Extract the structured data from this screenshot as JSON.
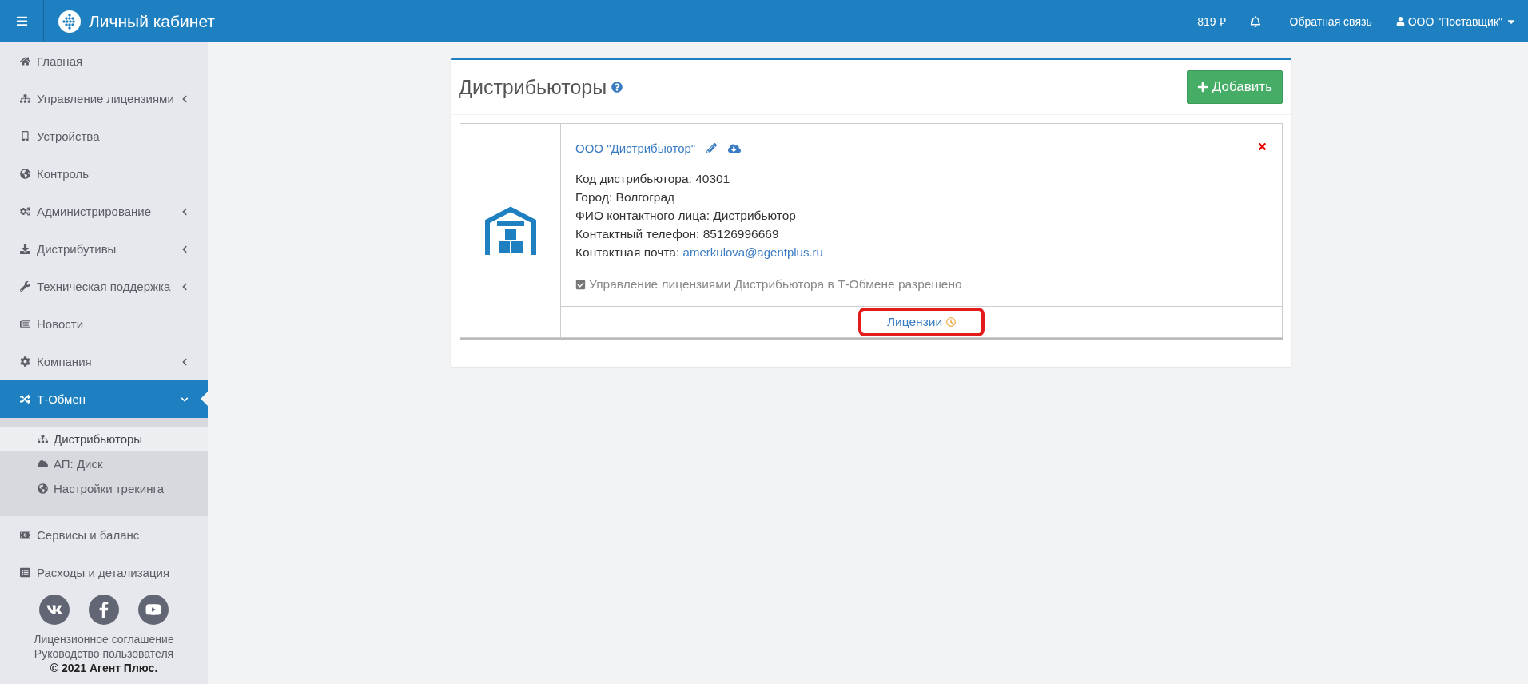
{
  "header": {
    "title": "Личный кабинет",
    "balance": "819 ₽",
    "feedback": "Обратная связь",
    "user": "ООО \"Поставщик\""
  },
  "sidebar": {
    "items": [
      {
        "label": "Главная",
        "selected": false
      },
      {
        "label": "Управление лицензиями",
        "selected": false,
        "expanded": false
      },
      {
        "label": "Устройства",
        "selected": false
      },
      {
        "label": "Контроль",
        "selected": false
      },
      {
        "label": "Администрирование",
        "selected": false,
        "expanded": false
      },
      {
        "label": "Дистрибутивы",
        "selected": false,
        "expanded": false
      },
      {
        "label": "Техническая поддержка",
        "selected": false,
        "expanded": false
      },
      {
        "label": "Новости",
        "selected": false
      },
      {
        "label": "Компания",
        "selected": false,
        "expanded": false
      },
      {
        "label": "Т-Обмен",
        "selected": true,
        "expanded": true,
        "children": [
          {
            "label": "Дистрибьюторы",
            "selected": true
          },
          {
            "label": "АП: Диск",
            "selected": false
          },
          {
            "label": "Настройки трекинга",
            "selected": false
          }
        ]
      },
      {
        "label": "Сервисы и баланс",
        "selected": false
      },
      {
        "label": "Расходы и детализация",
        "selected": false
      }
    ],
    "footer_links": [
      "Лицензионное соглашение",
      "Руководство пользователя"
    ],
    "copyright": "© 2021 Агент Плюс."
  },
  "panel": {
    "title": "Дистрибьюторы",
    "add_button": "Добавить",
    "distributors": [
      {
        "name": "ООО \"Дистрибьютор\"",
        "fields": [
          {
            "label": "Код дистрибьютора:",
            "value": "40301"
          },
          {
            "label": "Город:",
            "value": "Волгоград"
          },
          {
            "label": "ФИО контактного лица:",
            "value": "Дистрибьютор"
          },
          {
            "label": "Контактный телефон:",
            "value": "85126996669"
          },
          {
            "label": "Контактная почта:",
            "value": "amerkulova@agentplus.ru",
            "kind": "link"
          }
        ],
        "permission": {
          "label": "Управление лицензиями Дистрибьютора в Т-Обмене разрешено",
          "checked": true
        },
        "licenses_link": {
          "label": "Лицензии",
          "highlighted": true
        }
      }
    ]
  }
}
